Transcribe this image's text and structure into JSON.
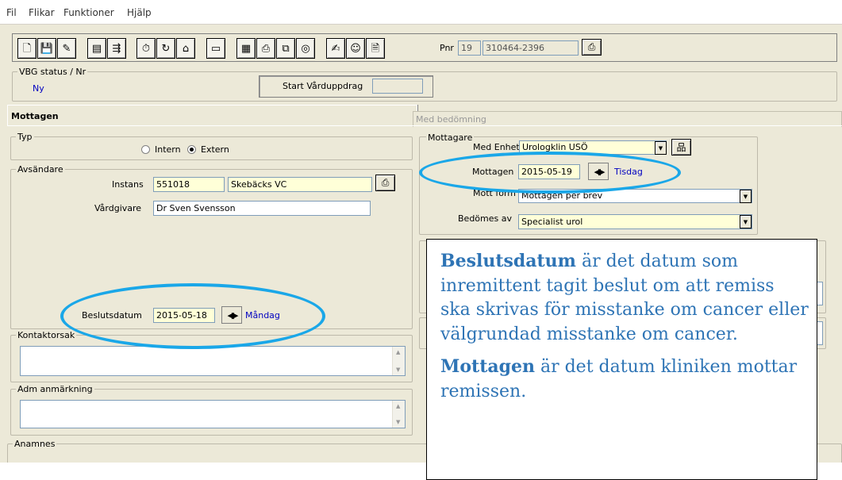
{
  "menu": [
    "Fil",
    "Flikar",
    "Funktioner",
    "Hjälp"
  ],
  "toolbar": {
    "icons": [
      "new-document-icon",
      "save-icon",
      "document-edit-icon",
      "forward-icon",
      "export-icon",
      "clock-icon",
      "clock-arrow-icon",
      "house-icon",
      "print-preview-icon",
      "document-list-icon",
      "printer-icon",
      "document-copy-icon",
      "cd-icon",
      "notes-icon",
      "smiley-icon",
      "document-lock-icon"
    ],
    "pnr_label": "Pnr",
    "pnr_century": "19",
    "pnr_value": "310464-2396"
  },
  "status": {
    "legend": "VBG status / Nr",
    "value": "Ny",
    "start_label": "Start Vårduppdrag",
    "start_value": ""
  },
  "tabs": {
    "left": "Mottagen",
    "right": "Med bedömning"
  },
  "typ": {
    "legend": "Typ",
    "intern": "Intern",
    "extern": "Extern",
    "selected": "extern"
  },
  "avsandare": {
    "legend": "Avsändare",
    "instans_label": "Instans",
    "instans_code": "551018",
    "instans_name": "Skebäcks VC",
    "vardgivare_label": "Vårdgivare",
    "vardgivare_value": "Dr Sven Svensson",
    "beslut_label": "Beslutsdatum",
    "beslut_date": "2015-05-18",
    "beslut_day": "Måndag"
  },
  "kontakt": {
    "legend": "Kontaktorsak"
  },
  "adm": {
    "legend": "Adm anmärkning"
  },
  "anamnes": {
    "legend": "Anamnes"
  },
  "mottagare": {
    "legend": "Mottagare",
    "enhet_label": "Med Enhet",
    "enhet_value": "Urologklin USÖ",
    "mottagen_label": "Mottagen",
    "mottagen_date": "2015-05-19",
    "mottagen_day": "Tisdag",
    "form_label": "Mott form",
    "form_value": "Mottagen per brev",
    "bedomes_label": "Bedömes av",
    "bedomes_value": "Specialist urol"
  },
  "note": {
    "p1_bold": "Beslutsdatum",
    "p1_text": " är det datum som inremittent tagit beslut om att remiss ska skrivas för misstanke om cancer eller välgrundad misstanke om cancer.",
    "p2_bold": "Mottagen",
    "p2_text": " är det datum kliniken mottar remissen."
  },
  "colors": {
    "highlight_ellipse": "#1aa7e8",
    "note_text": "#2e74b5",
    "field_yellow": "#ffffd8",
    "label_blue": "#0000c0"
  }
}
